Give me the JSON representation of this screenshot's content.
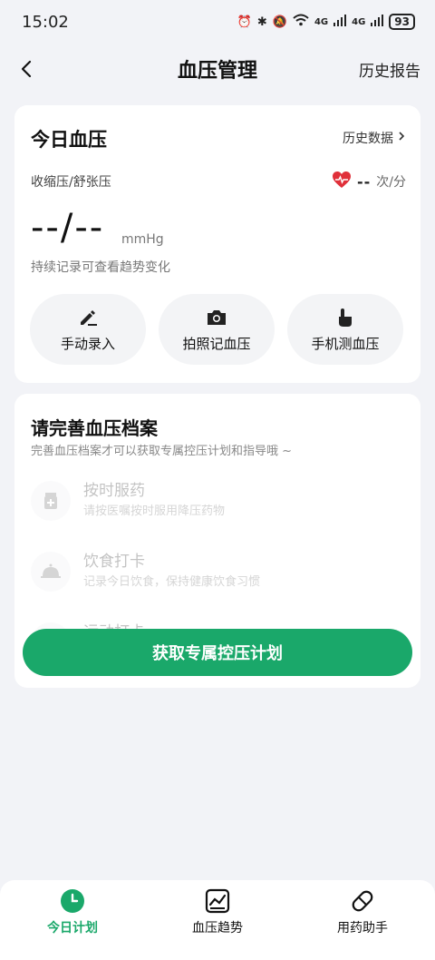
{
  "status": {
    "time": "15:02",
    "battery": "93",
    "signal1": "4G",
    "signal2": "4G"
  },
  "nav": {
    "title": "血压管理",
    "right": "历史报告"
  },
  "today": {
    "title": "今日血压",
    "history_link": "历史数据",
    "bp_label": "收缩压/舒张压",
    "heart_value": "--",
    "heart_unit": "次/分",
    "bp_value": "--/--",
    "bp_unit": "mmHg",
    "hint": "持续记录可查看趋势变化",
    "actions": [
      {
        "label": "手动录入",
        "icon": "pencil-icon"
      },
      {
        "label": "拍照记血压",
        "icon": "camera-icon"
      },
      {
        "label": "手机测血压",
        "icon": "finger-icon"
      }
    ]
  },
  "profile": {
    "title": "请完善血压档案",
    "subtitle": "完善血压档案才可以获取专属控压计划和指导哦 ~",
    "tasks": [
      {
        "title": "按时服药",
        "desc": "请按医嘱按时服用降压药物",
        "icon": "pill-bottle-icon"
      },
      {
        "title": "饮食打卡",
        "desc": "记录今日饮食，保持健康饮食习惯",
        "icon": "food-dish-icon"
      },
      {
        "title": "运动打卡",
        "desc": "",
        "icon": "exercise-icon"
      }
    ],
    "cta": "获取专属控压计划"
  },
  "tabs": [
    {
      "label": "今日计划",
      "icon": "clock-icon",
      "active": true
    },
    {
      "label": "血压趋势",
      "icon": "chart-icon",
      "active": false
    },
    {
      "label": "用药助手",
      "icon": "pill-icon",
      "active": false
    }
  ],
  "colors": {
    "accent": "#1aa86a",
    "heart": "#e0303a",
    "background": "#f2f3f7"
  }
}
